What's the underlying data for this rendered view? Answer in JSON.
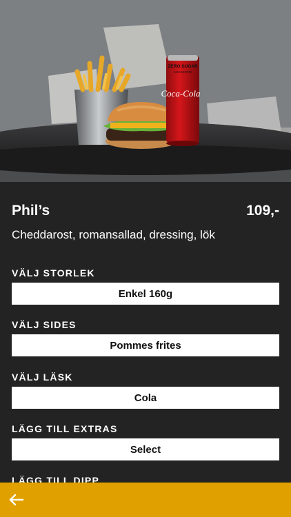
{
  "product": {
    "name": "Phil’s",
    "price": "109,-",
    "description": "Cheddarost, romansallad, dressing, lök"
  },
  "options": [
    {
      "label": "VÄLJ STORLEK",
      "value": "Enkel 160g"
    },
    {
      "label": "VÄLJ SIDES",
      "value": "Pommes frites"
    },
    {
      "label": "VÄLJ LÄSK",
      "value": "Cola"
    },
    {
      "label": "LÄGG TILL EXTRAS",
      "value": "Select"
    },
    {
      "label": "LÄGG TILL DIPP",
      "value": ""
    }
  ],
  "hero_image": {
    "can_top_text": "ZERO SUGAR",
    "can_sub_text": "SOCKERFRI",
    "can_brand": "Coca-Cola"
  },
  "bottom_bar": {
    "back_icon": "arrow-left-icon",
    "color": "#e0a100"
  },
  "colors": {
    "background": "#232323",
    "accent": "#e0a100"
  }
}
